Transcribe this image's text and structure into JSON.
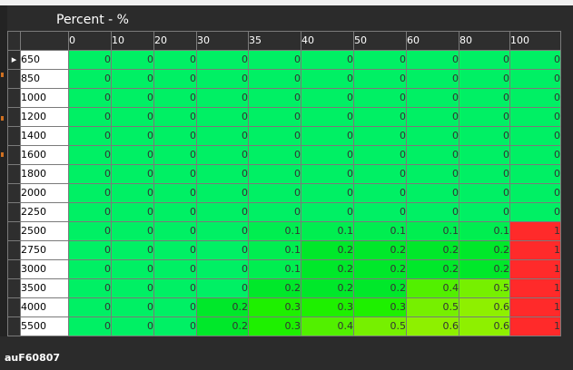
{
  "axis_title": "Percent - %",
  "columns": [
    "0",
    "10",
    "20",
    "30",
    "35",
    "40",
    "50",
    "60",
    "80",
    "100"
  ],
  "rows": [
    {
      "label": "650",
      "values": [
        "0",
        "0",
        "0",
        "0",
        "0",
        "0",
        "0",
        "0",
        "0",
        "0"
      ]
    },
    {
      "label": "850",
      "values": [
        "0",
        "0",
        "0",
        "0",
        "0",
        "0",
        "0",
        "0",
        "0",
        "0"
      ]
    },
    {
      "label": "1000",
      "values": [
        "0",
        "0",
        "0",
        "0",
        "0",
        "0",
        "0",
        "0",
        "0",
        "0"
      ]
    },
    {
      "label": "1200",
      "values": [
        "0",
        "0",
        "0",
        "0",
        "0",
        "0",
        "0",
        "0",
        "0",
        "0"
      ]
    },
    {
      "label": "1400",
      "values": [
        "0",
        "0",
        "0",
        "0",
        "0",
        "0",
        "0",
        "0",
        "0",
        "0"
      ]
    },
    {
      "label": "1600",
      "values": [
        "0",
        "0",
        "0",
        "0",
        "0",
        "0",
        "0",
        "0",
        "0",
        "0"
      ]
    },
    {
      "label": "1800",
      "values": [
        "0",
        "0",
        "0",
        "0",
        "0",
        "0",
        "0",
        "0",
        "0",
        "0"
      ]
    },
    {
      "label": "2000",
      "values": [
        "0",
        "0",
        "0",
        "0",
        "0",
        "0",
        "0",
        "0",
        "0",
        "0"
      ]
    },
    {
      "label": "2250",
      "values": [
        "0",
        "0",
        "0",
        "0",
        "0",
        "0",
        "0",
        "0",
        "0",
        "0"
      ]
    },
    {
      "label": "2500",
      "values": [
        "0",
        "0",
        "0",
        "0",
        "0.1",
        "0.1",
        "0.1",
        "0.1",
        "0.1",
        "1"
      ]
    },
    {
      "label": "2750",
      "values": [
        "0",
        "0",
        "0",
        "0",
        "0.1",
        "0.2",
        "0.2",
        "0.2",
        "0.2",
        "1"
      ]
    },
    {
      "label": "3000",
      "values": [
        "0",
        "0",
        "0",
        "0",
        "0.1",
        "0.2",
        "0.2",
        "0.2",
        "0.2",
        "1"
      ]
    },
    {
      "label": "3500",
      "values": [
        "0",
        "0",
        "0",
        "0",
        "0.2",
        "0.2",
        "0.2",
        "0.4",
        "0.5",
        "1"
      ]
    },
    {
      "label": "4000",
      "values": [
        "0",
        "0",
        "0",
        "0.2",
        "0.3",
        "0.3",
        "0.3",
        "0.5",
        "0.6",
        "1"
      ]
    },
    {
      "label": "5500",
      "values": [
        "0",
        "0",
        "0",
        "0.2",
        "0.3",
        "0.4",
        "0.5",
        "0.6",
        "0.6",
        "1"
      ]
    }
  ],
  "selected_row_marker": "▸",
  "footer_label": "auF60807",
  "colors": {
    "zero": "#00f064",
    "v0_1": "#00ee50",
    "v0_2": "#00e82a",
    "v0_3": "#1ef000",
    "v0_4": "#52f000",
    "v0_5": "#76f000",
    "v0_6": "#8ef000",
    "v1": "#ff2a2a"
  }
}
